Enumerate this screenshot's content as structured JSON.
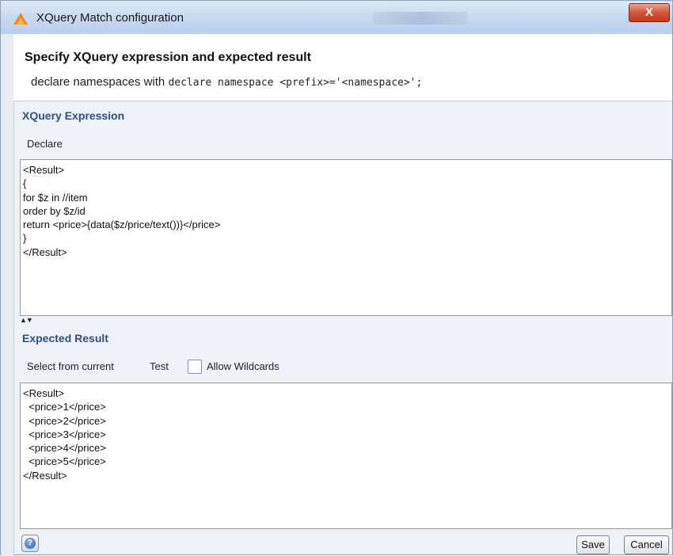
{
  "window": {
    "title": "XQuery Match configuration",
    "close_label": "X"
  },
  "header": {
    "title": "Specify XQuery expression and expected result",
    "desc_prefix": "declare namespaces with ",
    "desc_code": "declare namespace <prefix>='<namespace>';"
  },
  "expression": {
    "section_title": "XQuery Expression",
    "declare_label": "Declare",
    "lines": [
      "<Result>",
      "{",
      "for $z in //item",
      "order by $z/id",
      "return <price>{data($z/price/text())}</price>",
      "}",
      "</Result>"
    ]
  },
  "splitter": {
    "label": "▲▼"
  },
  "expected": {
    "section_title": "Expected Result",
    "select_label": "Select from current",
    "test_label": "Test",
    "wildcards_label": "Allow Wildcards",
    "wildcards_checked": false,
    "lines": [
      "<Result>",
      "  <price>1</price>",
      "  <price>2</price>",
      "  <price>3</price>",
      "  <price>4</price>",
      "  <price>5</price>",
      "</Result>"
    ]
  },
  "footer": {
    "help_icon": "help-icon",
    "save_label": "Save",
    "cancel_label": "Cancel"
  },
  "colors": {
    "section_title": "#2d4f8f",
    "close_button": "#c0391d",
    "app_icon": "#f08a24"
  }
}
